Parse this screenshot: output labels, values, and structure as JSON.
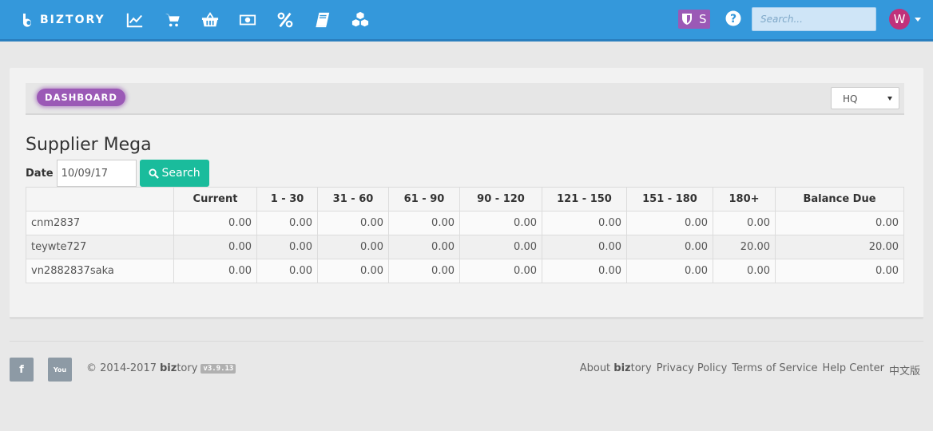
{
  "app": {
    "brand": "BIZTORY",
    "colors": {
      "nav": "#3498db",
      "accent": "#9b59b6",
      "button": "#1abc9c",
      "avatar": "#c0317a"
    }
  },
  "nav": {
    "icons": [
      "chart-line-icon",
      "cart-icon",
      "basket-icon",
      "money-icon",
      "percent-icon",
      "book-icon",
      "cubes-icon"
    ],
    "shield_letter": "S",
    "search_placeholder": "Search...",
    "avatar_letter": "W"
  },
  "breadcrumb": {
    "label": "DASHBOARD"
  },
  "branch": {
    "selected": "HQ"
  },
  "page": {
    "title": "Supplier Mega"
  },
  "filter": {
    "date_label": "Date",
    "date_value": "10/09/17",
    "search_label": "Search"
  },
  "table": {
    "headers": [
      "",
      "Current",
      "1 - 30",
      "31 - 60",
      "61 - 90",
      "90 - 120",
      "121 - 150",
      "151 - 180",
      "180+",
      "Balance Due"
    ],
    "rows": [
      [
        "cnm2837",
        "0.00",
        "0.00",
        "0.00",
        "0.00",
        "0.00",
        "0.00",
        "0.00",
        "0.00",
        "0.00"
      ],
      [
        "teywte727",
        "0.00",
        "0.00",
        "0.00",
        "0.00",
        "0.00",
        "0.00",
        "0.00",
        "20.00",
        "20.00"
      ],
      [
        "vn2882837saka",
        "0.00",
        "0.00",
        "0.00",
        "0.00",
        "0.00",
        "0.00",
        "0.00",
        "0.00",
        "0.00"
      ]
    ]
  },
  "footer": {
    "facebook": "f",
    "youtube": "You",
    "copyright": "© 2014-2017",
    "brand_bold": "biz",
    "brand_rest": "tory",
    "version": "v3.9.13",
    "about_prefix": "About",
    "about_bold": "biz",
    "about_rest": "tory",
    "links": [
      "Privacy Policy",
      "Terms of Service",
      "Help Center",
      "中文版"
    ]
  }
}
